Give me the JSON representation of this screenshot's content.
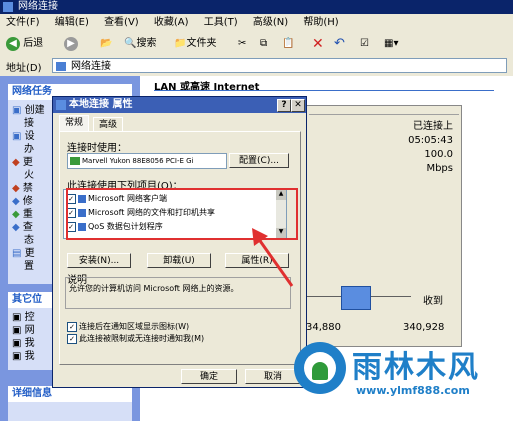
{
  "window": {
    "title": "网络连接"
  },
  "menu": [
    "文件(F)",
    "编辑(E)",
    "查看(V)",
    "收藏(A)",
    "工具(T)",
    "高级(N)",
    "帮助(H)"
  ],
  "toolbar": {
    "back": "后退",
    "search": "搜索",
    "folders": "文件夹"
  },
  "address": {
    "label": "地址(D)",
    "value": "网络连接"
  },
  "taskpane": {
    "network_tasks": "网络任务",
    "task_items": [
      "创建",
      "接",
      "设",
      "办",
      "更",
      "火",
      "禁",
      "修",
      "重",
      "查",
      "态",
      "更",
      "置"
    ],
    "other_places": "其它位",
    "other_items": [
      "控",
      "网",
      "我",
      "我"
    ],
    "details": "详细信息"
  },
  "main": {
    "header": "LAN 或高速 Internet"
  },
  "status": {
    "connected": "已连接上",
    "duration": "05:05:43",
    "speed": "100.0 Mbps",
    "received_label": "收到",
    "sent": "34,880",
    "received": "340,928"
  },
  "dialog": {
    "title": "本地连接 属性",
    "tabs": [
      "常规",
      "高级"
    ],
    "connect_using_label": "连接时使用：",
    "adapter": "Marvell Yukon 88E8056 PCI-E Gi",
    "configure": "配置(C)...",
    "items_label": "此连接使用下列项目(O)：",
    "items": [
      "Microsoft 网络客户端",
      "Microsoft 网络的文件和打印机共享",
      "QoS 数据包计划程序"
    ],
    "install": "安装(N)...",
    "uninstall": "卸载(U)",
    "properties": "属性(R)",
    "desc_label": "说明",
    "description": "允许您的计算机访问 Microsoft 网络上的资源。",
    "show_icon": "连接后在通知区域显示图标(W)",
    "notify_limited": "此连接被限制或无连接时通知我(M)",
    "ok": "确定",
    "cancel": "取消"
  },
  "watermark": {
    "brand": "雨林木风",
    "url": "www.ylmf888.com"
  },
  "colors": {
    "accent": "#0a246a",
    "highlight": "#e03030",
    "brand": "#1f7fc8"
  }
}
